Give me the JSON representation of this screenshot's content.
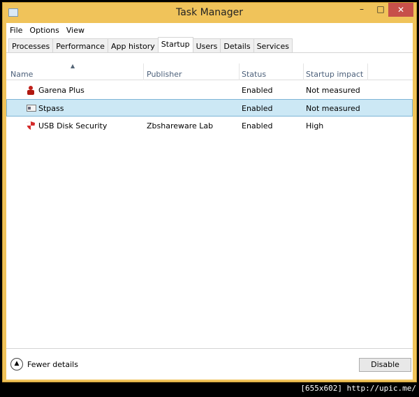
{
  "window": {
    "title": "Task Manager",
    "minimize": "–",
    "maximize": "□",
    "close": "✕"
  },
  "menu": [
    "File",
    "Options",
    "View"
  ],
  "tabs": [
    "Processes",
    "Performance",
    "App history",
    "Startup",
    "Users",
    "Details",
    "Services"
  ],
  "active_tab": "Startup",
  "columns": {
    "name": "Name",
    "publisher": "Publisher",
    "status": "Status",
    "impact": "Startup impact"
  },
  "rows": [
    {
      "name": "Garena Plus",
      "publisher": "",
      "status": "Enabled",
      "impact": "Not measured"
    },
    {
      "name": "Stpass",
      "publisher": "",
      "status": "Enabled",
      "impact": "Not measured"
    },
    {
      "name": "USB Disk Security",
      "publisher": "Zbshareware Lab",
      "status": "Enabled",
      "impact": "High"
    }
  ],
  "footer": {
    "fewer_details": "Fewer details",
    "disable": "Disable"
  },
  "watermark": "[655x602] http://upic.me/"
}
